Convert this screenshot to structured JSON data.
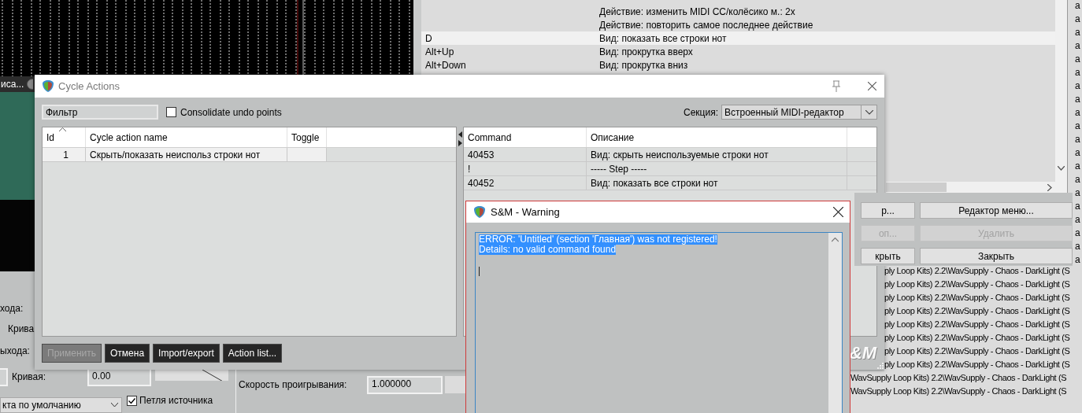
{
  "piano_roll": {
    "track_label": "иса..."
  },
  "item_properties": {
    "fade_in_label": "хода:",
    "fade_in_curve_label": "Крива",
    "fade_out_label": "ыхода:",
    "fade_out_curve_label": "Кривая:",
    "fade_out_curve_value": "0.00",
    "playrate_label": "Скорость проигрывания:",
    "playrate_value": "1.000000",
    "dropdown_value": "кта по умолчанию",
    "loop_source": {
      "label": "Петля источника",
      "checked": true
    }
  },
  "actions_window": {
    "rows": [
      {
        "description": "Действие: изменить MIDI CC/колёсико м.: 2x",
        "selected": false
      },
      {
        "description": "Действие: повторить самое последнее действие",
        "selected": false
      },
      {
        "shortcut": "D",
        "description": "Вид: показать все строки нот",
        "selected": true
      },
      {
        "shortcut": "Alt+Up",
        "description": "Вид: прокрутка вверх",
        "selected": false
      },
      {
        "shortcut": "Alt+Down",
        "description": "Вид: прокрутка вниз",
        "selected": false
      }
    ]
  },
  "side_list": {
    "cells": [
      "a",
      "a",
      "a",
      "a",
      "a",
      "a",
      "a",
      "a",
      "a",
      "a",
      "a",
      "a",
      "a",
      "a",
      "a",
      "a",
      "a",
      "a",
      "a",
      "a"
    ]
  },
  "actions_buttons": [
    {
      "label": "р...",
      "disabled": false
    },
    {
      "label": "Редактор меню...",
      "disabled": false
    },
    {
      "label": "оп...",
      "disabled": true
    },
    {
      "label": "Удалить",
      "disabled": true
    },
    {
      "label": "крыть",
      "disabled": false
    },
    {
      "label": "Закрыть",
      "disabled": false
    }
  ],
  "file_list": {
    "rows": [
      "ply Loop Kits) 2.2\\WavSupply - Chaos - DarkLight (S",
      "ply Loop Kits) 2.2\\WavSupply - Chaos - DarkLight (S",
      "ply Loop Kits) 2.2\\WavSupply - Chaos - DarkLight (S",
      "ply Loop Kits) 2.2\\WavSupply - Chaos - DarkLight (S",
      "ply Loop Kits) 2.2\\WavSupply - Chaos - DarkLight (S",
      "ply Loop Kits) 2.2\\WavSupply - Chaos - DarkLight (S",
      "ply Loop Kits) 2.2\\WavSupply - Chaos - DarkLight (S",
      "ply Loop Kits) 2.2\\WavSupply - Chaos - DarkLight (S"
    ]
  },
  "file_list_lower": {
    "rows": [
      "WavSupply Loop Kits) 2.2\\WavSupply - Chaos - DarkLight (S",
      "WavSupply Loop Kits) 2.2\\WavSupply - Chaos - DarkLight (S"
    ]
  },
  "cycle_actions": {
    "title": "Cycle Actions",
    "filter_placeholder": "Фильтр",
    "consolidate": {
      "label": "Consolidate undo points",
      "checked": false
    },
    "section_label": "Секция:",
    "section_value": "Встроенный MIDI-редактор",
    "left_columns": [
      "Id",
      "Cycle action name",
      "Toggle"
    ],
    "left_rows": [
      {
        "id": "1",
        "name": "Скрыть/показать неиспольз строки нот",
        "selected": true
      }
    ],
    "right_columns": [
      "Command",
      "Описание"
    ],
    "right_rows": [
      {
        "command": "40453",
        "description": "Вид: скрыть неиспользуемые строки нот"
      },
      {
        "command": "!",
        "description": "----- Step -----"
      },
      {
        "command": "40452",
        "description": "Вид: показать все строки нот"
      }
    ],
    "buttons": [
      {
        "label": "Применить",
        "disabled": true
      },
      {
        "label": "Отмена",
        "disabled": false
      },
      {
        "label": "Import/export",
        "disabled": false
      },
      {
        "label": "Action list...",
        "disabled": false
      }
    ],
    "logo_text": "&M"
  },
  "warning": {
    "title": "S&M - Warning",
    "lines": [
      "ERROR: 'Untitled' (section 'Главная') was not registered!",
      "Details: no valid command found"
    ]
  }
}
